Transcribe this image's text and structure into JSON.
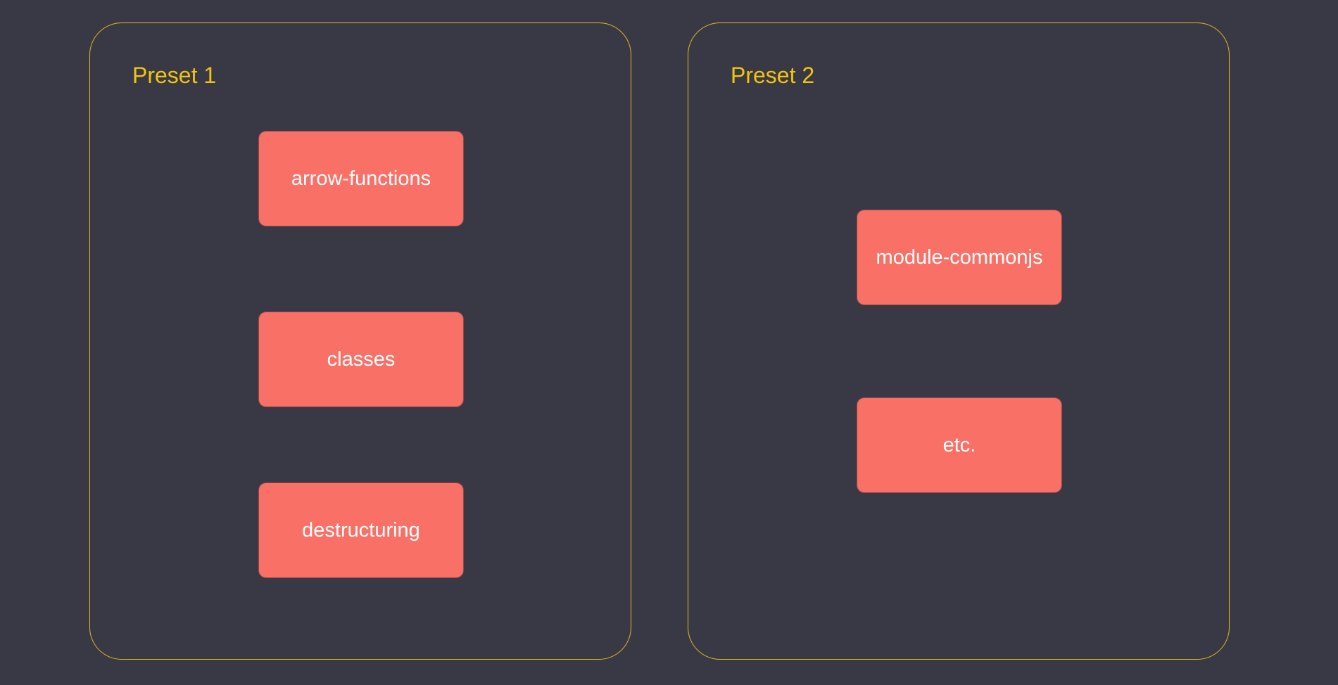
{
  "colors": {
    "background": "#393945",
    "frame_border": "#e6b91e",
    "title_text": "#f2c40f",
    "plugin_fill": "#f87066",
    "plugin_text": "#ffffff"
  },
  "presets": [
    {
      "title": "Preset 1",
      "plugins": [
        "arrow-functions",
        "classes",
        "destructuring"
      ]
    },
    {
      "title": "Preset 2",
      "plugins": [
        "module-commonjs",
        "etc."
      ]
    }
  ]
}
